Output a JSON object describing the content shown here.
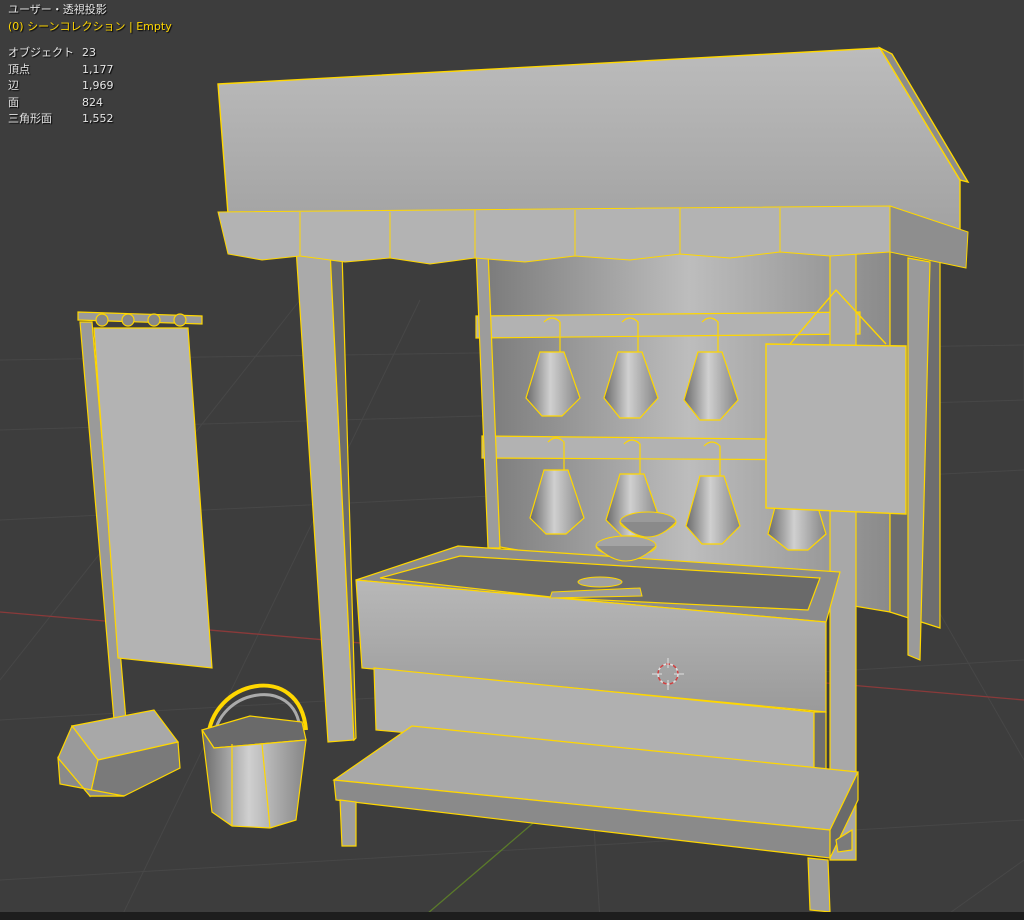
{
  "viewport": {
    "view_label": "ユーザー・透視投影",
    "collection_label": "(0) シーンコレクション | Empty"
  },
  "stats": [
    {
      "label": "オブジェクト",
      "value": "23"
    },
    {
      "label": "頂点",
      "value": "1,177"
    },
    {
      "label": "辺",
      "value": "1,969"
    },
    {
      "label": "面",
      "value": "824"
    },
    {
      "label": "三角形面",
      "value": "1,552"
    }
  ],
  "colors": {
    "background": "#3d3d3d",
    "grid": "#4a4a4a",
    "x_axis": "#8a3a3a",
    "y_axis": "#5a7a2a",
    "selection_outline": "#ffd700",
    "mesh_light": "#b4b4b4",
    "mesh_dark": "#707070"
  }
}
